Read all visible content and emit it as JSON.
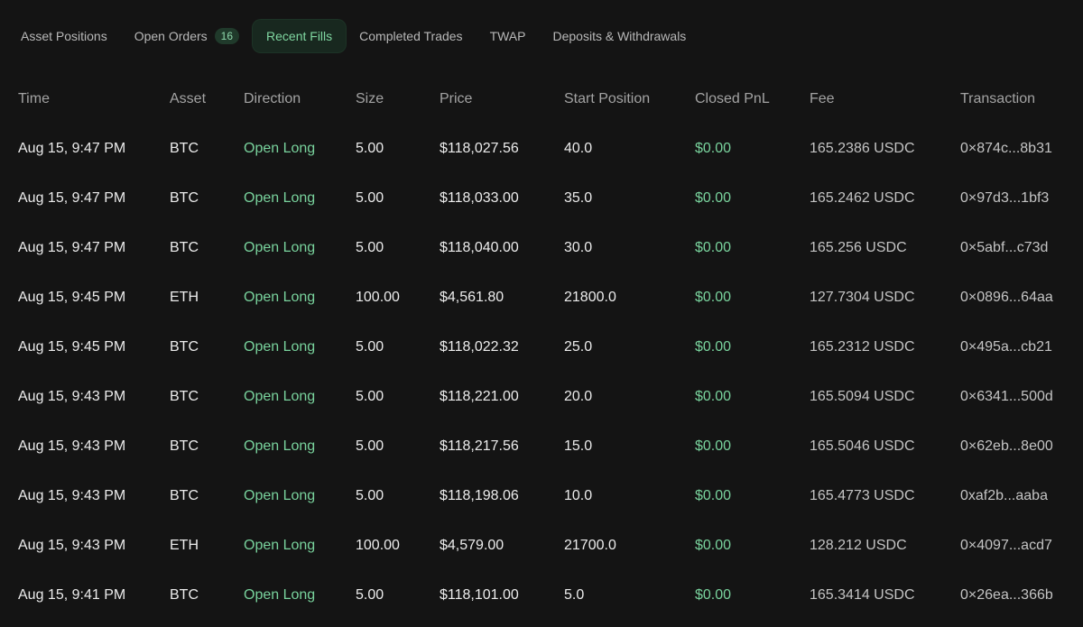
{
  "tabs": [
    {
      "label": "Asset Positions"
    },
    {
      "label": "Open Orders",
      "badge": "16"
    },
    {
      "label": "Recent Fills"
    },
    {
      "label": "Completed Trades"
    },
    {
      "label": "TWAP"
    },
    {
      "label": "Deposits & Withdrawals"
    }
  ],
  "active_tab": "Recent Fills",
  "colors": {
    "accent": "#79d39d",
    "background": "#141414"
  },
  "table": {
    "headers": [
      "Time",
      "Asset",
      "Direction",
      "Size",
      "Price",
      "Start Position",
      "Closed PnL",
      "Fee",
      "Transaction"
    ],
    "rows": [
      [
        "Aug 15, 9:47 PM",
        "BTC",
        "Open Long",
        "5.00",
        "$118,027.56",
        "40.0",
        "$0.00",
        "165.2386 USDC",
        "0×874c...8b31"
      ],
      [
        "Aug 15, 9:47 PM",
        "BTC",
        "Open Long",
        "5.00",
        "$118,033.00",
        "35.0",
        "$0.00",
        "165.2462 USDC",
        "0×97d3...1bf3"
      ],
      [
        "Aug 15, 9:47 PM",
        "BTC",
        "Open Long",
        "5.00",
        "$118,040.00",
        "30.0",
        "$0.00",
        "165.256 USDC",
        "0×5abf...c73d"
      ],
      [
        "Aug 15, 9:45 PM",
        "ETH",
        "Open Long",
        "100.00",
        "$4,561.80",
        "21800.0",
        "$0.00",
        "127.7304 USDC",
        "0×0896...64aa"
      ],
      [
        "Aug 15, 9:45 PM",
        "BTC",
        "Open Long",
        "5.00",
        "$118,022.32",
        "25.0",
        "$0.00",
        "165.2312 USDC",
        "0×495a...cb21"
      ],
      [
        "Aug 15, 9:43 PM",
        "BTC",
        "Open Long",
        "5.00",
        "$118,221.00",
        "20.0",
        "$0.00",
        "165.5094 USDC",
        "0×6341...500d"
      ],
      [
        "Aug 15, 9:43 PM",
        "BTC",
        "Open Long",
        "5.00",
        "$118,217.56",
        "15.0",
        "$0.00",
        "165.5046 USDC",
        "0×62eb...8e00"
      ],
      [
        "Aug 15, 9:43 PM",
        "BTC",
        "Open Long",
        "5.00",
        "$118,198.06",
        "10.0",
        "$0.00",
        "165.4773 USDC",
        "0xaf2b...aaba"
      ],
      [
        "Aug 15, 9:43 PM",
        "ETH",
        "Open Long",
        "100.00",
        "$4,579.00",
        "21700.0",
        "$0.00",
        "128.212 USDC",
        "0×4097...acd7"
      ],
      [
        "Aug 15, 9:41 PM",
        "BTC",
        "Open Long",
        "5.00",
        "$118,101.00",
        "5.0",
        "$0.00",
        "165.3414 USDC",
        "0×26ea...366b"
      ]
    ]
  }
}
